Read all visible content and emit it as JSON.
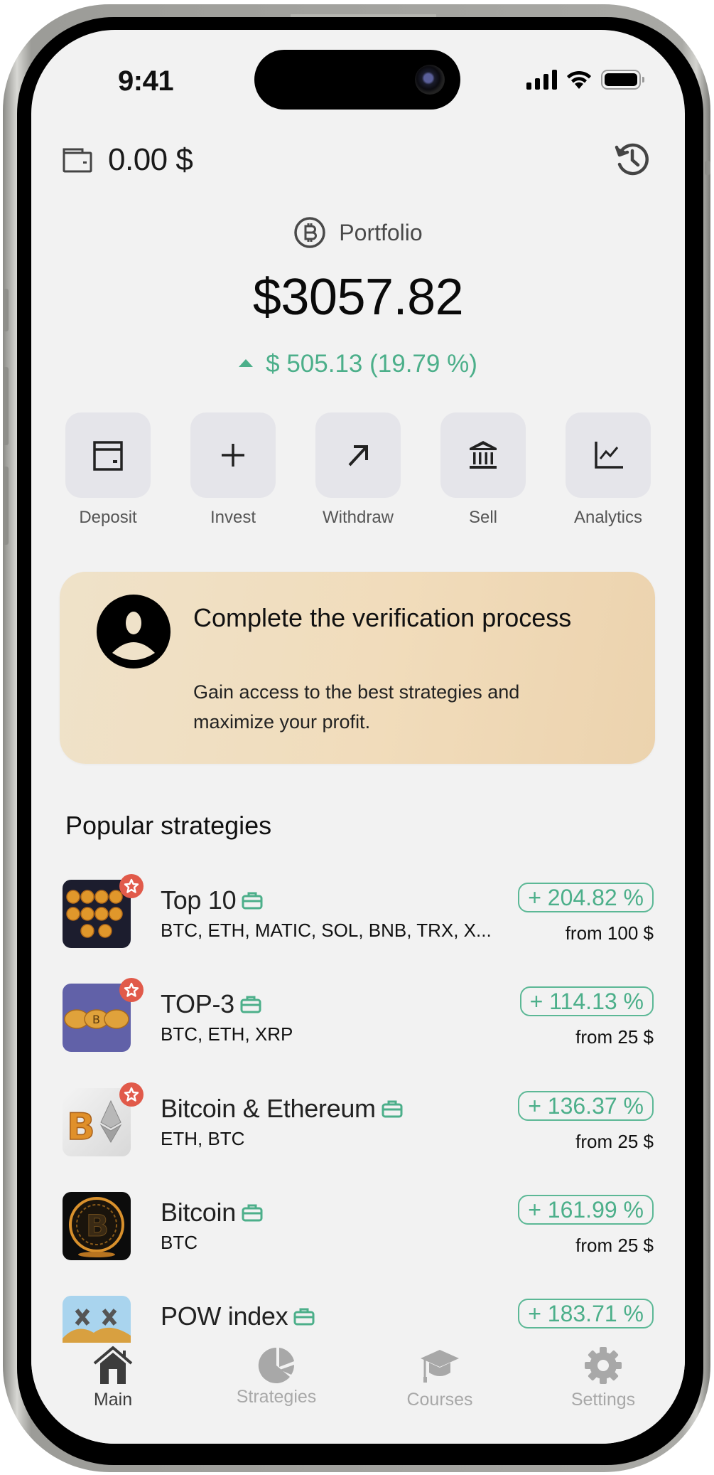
{
  "status_bar": {
    "time": "9:41"
  },
  "header": {
    "wallet_balance": "0.00 $",
    "wallet_icon": "wallet-icon",
    "history_icon": "history-icon"
  },
  "portfolio": {
    "label": "Portfolio",
    "icon": "bitcoin-circle-icon",
    "total": "$3057.82",
    "change": "$ 505.13 (19.79 %)",
    "change_direction": "up"
  },
  "actions": [
    {
      "label": "Deposit",
      "icon": "deposit-icon"
    },
    {
      "label": "Invest",
      "icon": "plus-icon"
    },
    {
      "label": "Withdraw",
      "icon": "arrow-up-right-icon"
    },
    {
      "label": "Sell",
      "icon": "bank-icon"
    },
    {
      "label": "Analytics",
      "icon": "chart-line-icon"
    }
  ],
  "banner": {
    "title": "Complete the verification process",
    "description": "Gain access to the best strategies and maximize your profit.",
    "icon": "user-circle-icon"
  },
  "strategies_section": {
    "title": "Popular strategies",
    "items": [
      {
        "name": "Top 10",
        "coins": "BTC, ETH, MATIC, SOL, BNB, TRX, X...",
        "return": "+ 204.82 %",
        "min": "from 100 $",
        "featured": true
      },
      {
        "name": "TOP-3",
        "coins": "BTC, ETH, XRP",
        "return": "+ 114.13 %",
        "min": "from 25 $",
        "featured": true
      },
      {
        "name": "Bitcoin & Ethereum",
        "coins": "ETH, BTC",
        "return": "+ 136.37 %",
        "min": "from 25 $",
        "featured": true
      },
      {
        "name": "Bitcoin",
        "coins": "BTC",
        "return": "+ 161.99 %",
        "min": "from 25 $",
        "featured": false
      },
      {
        "name": "POW index",
        "coins": "",
        "return": "+ 183.71 %",
        "min": "",
        "featured": false
      }
    ]
  },
  "bottom_nav": [
    {
      "label": "Main",
      "icon": "home-icon",
      "active": true
    },
    {
      "label": "Strategies",
      "icon": "pie-chart-icon",
      "active": false
    },
    {
      "label": "Courses",
      "icon": "graduation-cap-icon",
      "active": false
    },
    {
      "label": "Settings",
      "icon": "gear-icon",
      "active": false
    }
  ],
  "colors": {
    "accent_green": "#4caf8a",
    "badge_red": "#e15a4a",
    "screen_bg": "#f2f2f2",
    "action_bg": "#e5e5ea",
    "nav_active": "#3c3c3c",
    "nav_inactive": "#a8a8a8"
  }
}
